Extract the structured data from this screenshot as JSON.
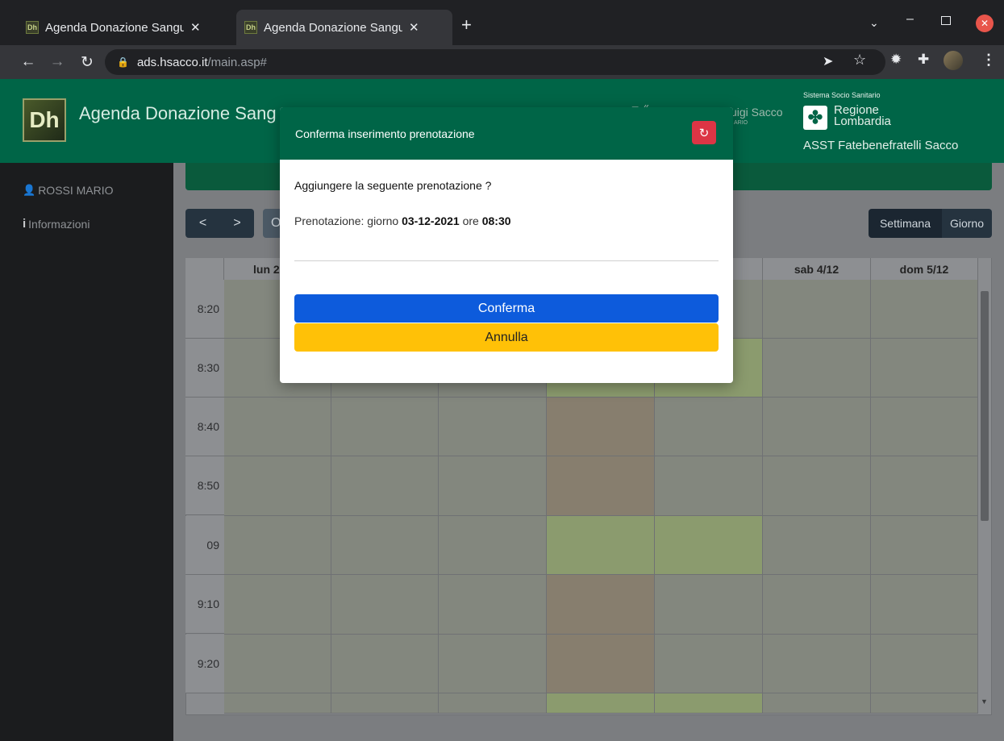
{
  "browser": {
    "tabs": [
      {
        "title": "Agenda Donazione Sangu",
        "favicon": "Dh"
      },
      {
        "title": "Agenda Donazione Sangu",
        "favicon": "Dh"
      }
    ],
    "url_host": "ads.hsacco.it",
    "url_path": "/main.asp#"
  },
  "app": {
    "logo_text": "Dh",
    "title": "Agenda Donazione Sang",
    "partial_hospital": "uigi Sacco",
    "partial_sub": "ARIO",
    "region_top": "Sistema Socio Sanitario",
    "region_name_1": "Regione",
    "region_name_2": "Lombardia",
    "asst": "ASST Fatebenefratelli Sacco"
  },
  "sidebar": {
    "items": [
      {
        "label": "ROSSI MARIO",
        "icon": "user-icon"
      },
      {
        "label": "Informazioni",
        "icon": "info-icon"
      }
    ]
  },
  "calendar": {
    "prev": "<",
    "next": ">",
    "today_partial": "O",
    "view_buttons": [
      "Settimana",
      "Giorno"
    ],
    "day_headers": [
      "lun 2",
      "sab 4/12",
      "dom 5/12"
    ],
    "times": [
      "8:20",
      "8:30",
      "8:40",
      "8:50",
      "09",
      "9:10",
      "9:20"
    ]
  },
  "modal": {
    "title": "Conferma inserimento prenotazione",
    "question": "Aggiungere la seguente prenotazione ?",
    "info_prefix": "Prenotazione: giorno",
    "date": "03-12-2021",
    "info_mid": "ore",
    "time": "08:30",
    "confirm": "Conferma",
    "cancel": "Annulla"
  },
  "colors": {
    "brand_green": "#006547",
    "confirm_blue": "#0d5bdc",
    "cancel_yellow": "#ffc107",
    "close_red": "#dc3545"
  }
}
